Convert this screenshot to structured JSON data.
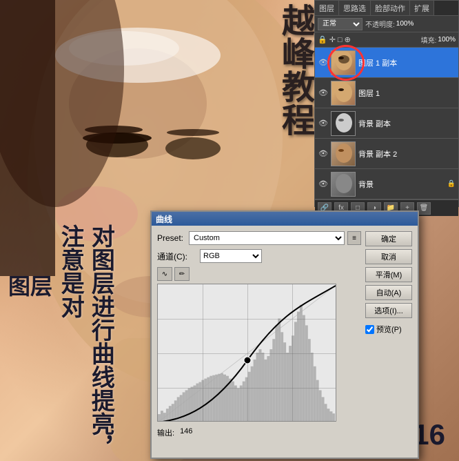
{
  "photo": {
    "alt": "Asian woman portrait"
  },
  "title_text": "越峰教程",
  "overlay_text": "对图层进行曲线提亮，注意是对",
  "layer_label": "图层",
  "page_number": "16",
  "layers_panel": {
    "title": "图层",
    "tabs": [
      "图层",
      "思路选",
      "脸部动作",
      "扩展"
    ],
    "blend_mode": "正常",
    "opacity_label": "不透明度:",
    "opacity_value": "100%",
    "fill_label": "填充:",
    "fill_value": "100%",
    "layers": [
      {
        "name": "图层 1 副本",
        "type": "face",
        "visible": true,
        "active": true
      },
      {
        "name": "图层 1",
        "type": "face",
        "visible": true,
        "active": false
      },
      {
        "name": "背景 副本",
        "type": "invert",
        "visible": true,
        "active": false
      },
      {
        "name": "背景 副本 2",
        "type": "bg2",
        "visible": true,
        "active": false
      },
      {
        "name": "背景",
        "type": "locked",
        "visible": true,
        "active": false,
        "locked": true
      }
    ]
  },
  "curves_dialog": {
    "title": "曲线",
    "preset_label": "Preset:",
    "preset_value": "Custom",
    "channel_label": "通道(C):",
    "channel_value": "RGB",
    "output_label": "输出:",
    "output_value": "146",
    "buttons": {
      "ok": "确定",
      "cancel": "取消",
      "smooth": "平滑(M)",
      "auto": "自动(A)",
      "options": "选项(I)...",
      "preview": "预览(P)"
    },
    "preview_checked": true
  }
}
